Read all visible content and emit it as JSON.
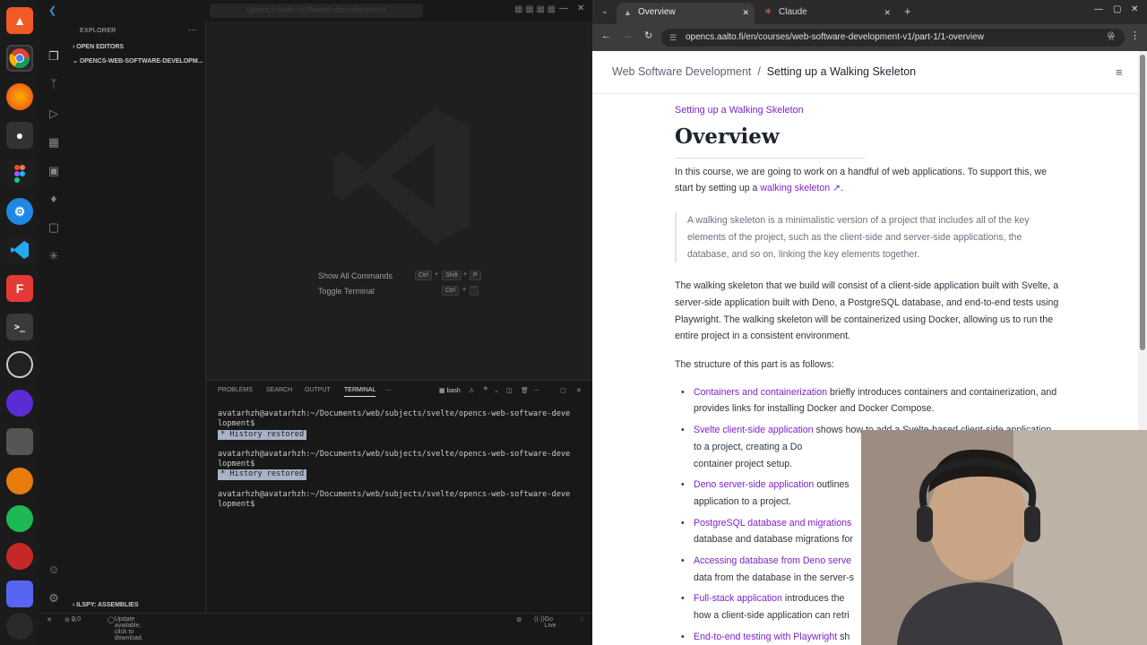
{
  "vscode": {
    "command_center": "opencs-web-software-development",
    "explorer_title": "EXPLORER",
    "open_editors": "OPEN EDITORS",
    "folder": "OPENCS-WEB-SOFTWARE-DEVELOPM...",
    "hints": [
      {
        "label": "Show All Commands",
        "keys": [
          "Ctrl",
          "+",
          "Shift",
          "+",
          "P"
        ]
      },
      {
        "label": "Toggle Terminal",
        "keys": [
          "Ctrl",
          "+",
          "`"
        ]
      }
    ],
    "panel_tabs": [
      "PROBLEMS",
      "SEARCH",
      "OUTPUT",
      "TERMINAL"
    ],
    "terminal_shell": "bash",
    "terminal_lines": [
      {
        "prompt": "avatarhzh@avatarhzh:~/Documents/web/subjects/svelte/opencs-web-software-deve",
        "cont": "lopment$"
      },
      {
        "badge": "History restored"
      },
      {
        "prompt": "avatarhzh@avatarhzh:~/Documents/web/subjects/svelte/opencs-web-software-deve",
        "cont": "lopment$"
      },
      {
        "badge": "History restored"
      },
      {
        "prompt": "avatarhzh@avatarhzh:~/Documents/web/subjects/svelte/opencs-web-software-deve",
        "cont": "lopment$"
      }
    ],
    "ilspy": "ILSPY: ASSEMBLIES",
    "status": {
      "errors": "0",
      "warnings": "0",
      "update": "Update available, click to download.",
      "golive": "Go Live"
    }
  },
  "chrome": {
    "tabs": [
      {
        "title": "Overview"
      },
      {
        "title": "Claude"
      }
    ],
    "url": "opencs.aalto.fi/en/courses/web-software-development-v1/part-1/1-overview"
  },
  "page": {
    "breadcrumb_course": "Web Software Development",
    "breadcrumb_sep": "/",
    "breadcrumb_current": "Setting up a Walking Skeleton",
    "kicker": "Setting up a Walking Skeleton",
    "title": "Overview",
    "intro_a": "In this course, we are going to work on a handful of web applications. To support this, we start by setting up a",
    "intro_link": "walking skeleton ↗",
    "intro_b": ".",
    "quote": "A walking skeleton is a minimalistic version of a project that includes all of the key elements of the project, such as the client-side and server-side applications, the database, and so on, linking the key elements together.",
    "para2": "The walking skeleton that we build will consist of a client-side application built with Svelte, a server-side application built with Deno, a PostgreSQL database, and end-to-end tests using Playwright. The walking skeleton will be containerized using Docker, allowing us to run the entire project in a consistent environment.",
    "para3": "The structure of this part is as follows:",
    "items": [
      {
        "link": "Containers and containerization",
        "text": " briefly introduces containers and containerization, and provides links for installing Docker and Docker Compose."
      },
      {
        "link": "Svelte client-side application",
        "text": " shows how to add a Svelte-based client-side application to a project, creating a Do"
      },
      {
        "link": "Deno server-side application",
        "text": " outlines"
      },
      {
        "link": "PostgreSQL database and migrations",
        "text": ""
      },
      {
        "link": "Accessing database from Deno serve",
        "text": ""
      },
      {
        "link": "Full-stack application",
        "text": " introduces the"
      },
      {
        "link": "End-to-end testing with Playwright",
        "text": " sh"
      }
    ],
    "item_tails": [
      "",
      "container project setup.",
      "application to a project.",
      "database and database migrations for",
      "data from the database in the server-s",
      "how a client-side application can retri",
      ""
    ]
  }
}
